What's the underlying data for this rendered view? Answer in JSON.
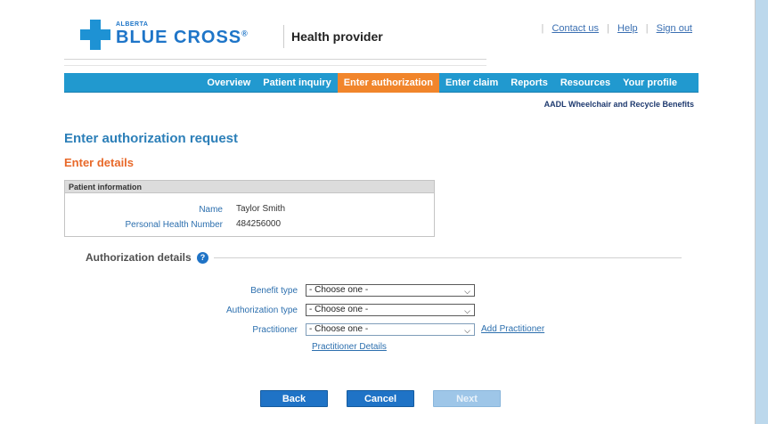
{
  "brand": {
    "region": "ALBERTA",
    "name": "BLUE CROSS",
    "registered_mark": "®",
    "product": "Health provider"
  },
  "top_links": [
    "Contact us",
    "Help",
    "Sign out"
  ],
  "nav": {
    "items": [
      "Overview",
      "Patient inquiry",
      "Enter authorization",
      "Enter claim",
      "Reports",
      "Resources",
      "Your profile"
    ],
    "active": "Enter authorization"
  },
  "program_name": "AADL Wheelchair and Recycle Benefits",
  "page_title": "Enter authorization request",
  "section_title": "Enter details",
  "patient": {
    "heading": "Patient information",
    "name_label": "Name",
    "name_value": "Taylor Smith",
    "phn_label": "Personal Health Number",
    "phn_value": "484256000"
  },
  "authorization": {
    "heading": "Authorization details",
    "help_icon": "question-circle-icon",
    "benefit_type_label": "Benefit type",
    "benefit_type_value": "- Choose one -",
    "authorization_type_label": "Authorization type",
    "authorization_type_value": "- Choose one -",
    "practitioner_label": "Practitioner",
    "practitioner_value": "- Choose one -",
    "add_practitioner": "Add Practitioner",
    "practitioner_details": "Practitioner Details"
  },
  "buttons": {
    "back": "Back",
    "cancel": "Cancel",
    "next": "Next"
  },
  "colors": {
    "brand_blue": "#1e75c8",
    "nav_blue": "#2199cf",
    "nav_active": "#f1852b",
    "section_orange": "#e8692a",
    "button_blue": "#1f73c6"
  }
}
